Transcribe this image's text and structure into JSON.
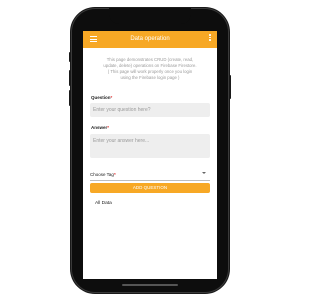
{
  "colors": {
    "accent": "#f7a825",
    "required": "#e23030",
    "field_bg": "#eeeeee"
  },
  "appbar": {
    "title": "Data operation",
    "menu_icon": "hamburger-menu-icon",
    "overflow_icon": "more-vertical-icon"
  },
  "intro": {
    "line1": "This page demonstrates CRUD (create, read,",
    "line2": "update, delete) operations on Firebase Firestore.",
    "line3": "( This page will work properly once you login",
    "line4": "using the Firebase login page )"
  },
  "form": {
    "question_label": "Question",
    "required_mark": "*",
    "question_placeholder": "Enter your question here?",
    "answer_label": "Answer",
    "answer_placeholder": "Enter your answer here...",
    "tag_label": "Choose Tag",
    "submit_label": "ADD QUESTION"
  },
  "list": {
    "all_data_label": "All Data"
  }
}
